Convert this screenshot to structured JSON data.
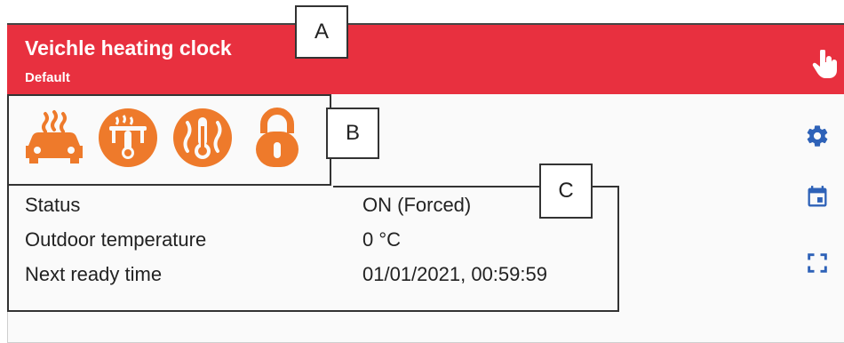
{
  "header": {
    "title": "Veichle heating clock",
    "subtitle": "Default"
  },
  "callouts": {
    "a": "A",
    "b": "B",
    "c": "C"
  },
  "feature_icons": [
    "car-heating-icon",
    "thermometer-sensor-icon",
    "heat-thermometer-icon",
    "lock-icon"
  ],
  "info": {
    "rows": [
      {
        "label": "Status",
        "value": "ON (Forced)"
      },
      {
        "label": "Outdoor temperature",
        "value": "0 °C"
      },
      {
        "label": "Next ready time",
        "value": "01/01/2021, 00:59:59"
      }
    ]
  },
  "sidebar_icons": [
    "gear-icon",
    "calendar-icon",
    "fullscreen-icon"
  ],
  "colors": {
    "header": "#e8303f",
    "feature_icon": "#ee7a2b",
    "sidebar_icon": "#2e62b8"
  }
}
